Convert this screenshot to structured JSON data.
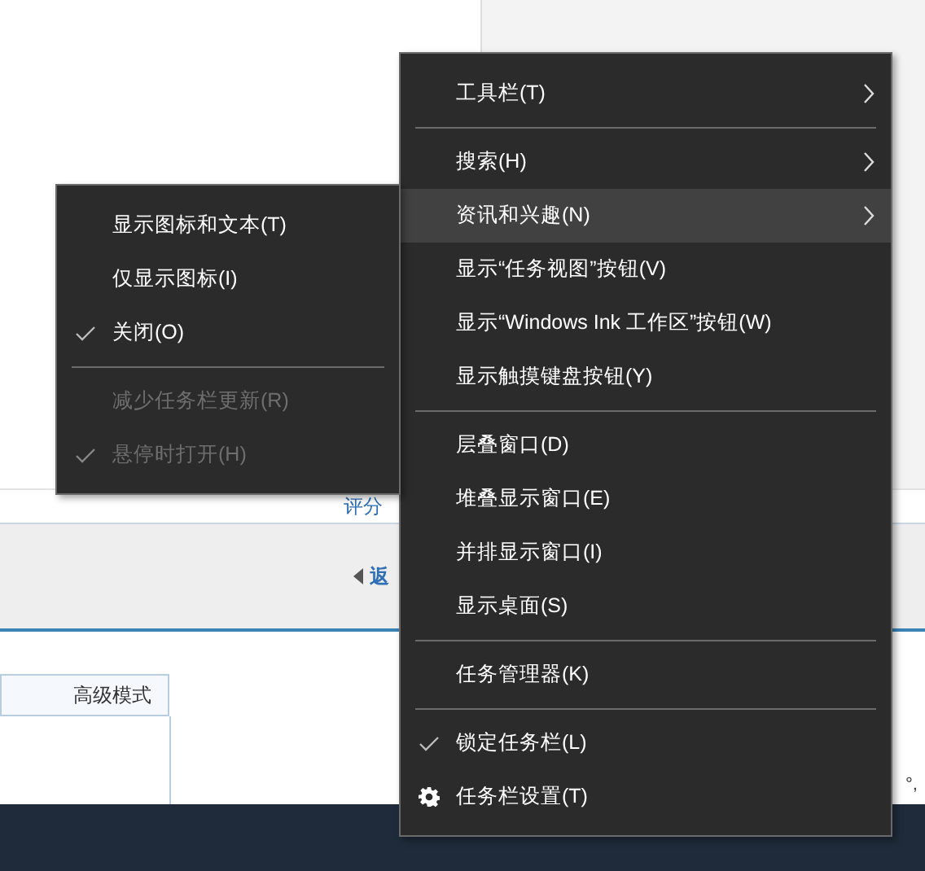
{
  "page": {
    "rating_link": "评分",
    "back_link": "返",
    "table_header": "高级模式",
    "edge_text": "°,"
  },
  "context_menu": {
    "items": [
      {
        "kind": "item",
        "label": "工具栏(T)",
        "submenu": true,
        "highlighted": false,
        "checked": false
      },
      {
        "kind": "separator"
      },
      {
        "kind": "item",
        "label": "搜索(H)",
        "submenu": true,
        "highlighted": false,
        "checked": false
      },
      {
        "kind": "item",
        "label": "资讯和兴趣(N)",
        "submenu": true,
        "highlighted": true,
        "checked": false
      },
      {
        "kind": "item",
        "label": "显示“任务视图”按钮(V)",
        "submenu": false,
        "highlighted": false,
        "checked": false
      },
      {
        "kind": "item",
        "label": "显示“Windows Ink 工作区”按钮(W)",
        "submenu": false,
        "highlighted": false,
        "checked": false
      },
      {
        "kind": "item",
        "label": "显示触摸键盘按钮(Y)",
        "submenu": false,
        "highlighted": false,
        "checked": false
      },
      {
        "kind": "separator"
      },
      {
        "kind": "item",
        "label": "层叠窗口(D)",
        "submenu": false,
        "highlighted": false,
        "checked": false
      },
      {
        "kind": "item",
        "label": "堆叠显示窗口(E)",
        "submenu": false,
        "highlighted": false,
        "checked": false
      },
      {
        "kind": "item",
        "label": "并排显示窗口(I)",
        "submenu": false,
        "highlighted": false,
        "checked": false
      },
      {
        "kind": "item",
        "label": "显示桌面(S)",
        "submenu": false,
        "highlighted": false,
        "checked": false
      },
      {
        "kind": "separator"
      },
      {
        "kind": "item",
        "label": "任务管理器(K)",
        "submenu": false,
        "highlighted": false,
        "checked": false
      },
      {
        "kind": "separator"
      },
      {
        "kind": "item",
        "label": "锁定任务栏(L)",
        "submenu": false,
        "highlighted": false,
        "checked": true
      },
      {
        "kind": "settings",
        "label": "任务栏设置(T)",
        "submenu": false,
        "highlighted": false
      }
    ]
  },
  "submenu": {
    "items": [
      {
        "kind": "item",
        "label": "显示图标和文本(T)",
        "checked": false,
        "disabled": false
      },
      {
        "kind": "item",
        "label": "仅显示图标(I)",
        "checked": false,
        "disabled": false
      },
      {
        "kind": "item",
        "label": "关闭(O)",
        "checked": true,
        "disabled": false
      },
      {
        "kind": "separator"
      },
      {
        "kind": "item",
        "label": "减少任务栏更新(R)",
        "checked": false,
        "disabled": true
      },
      {
        "kind": "item",
        "label": "悬停时打开(H)",
        "checked": true,
        "disabled": true
      }
    ]
  }
}
